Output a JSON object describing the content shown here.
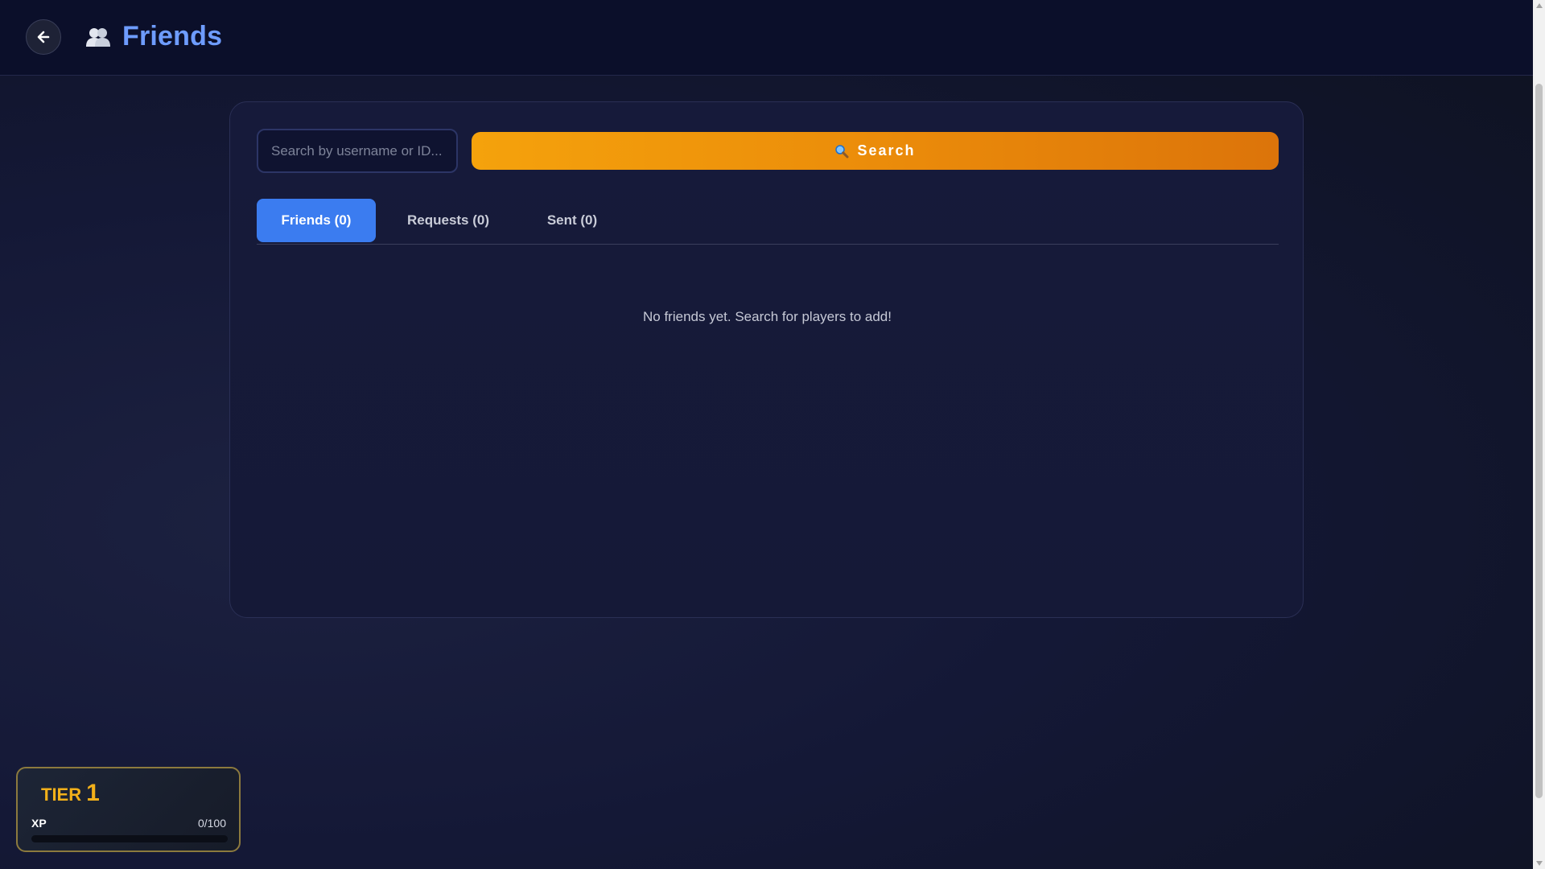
{
  "header": {
    "title": "Friends",
    "back_icon": "arrow-left-icon",
    "title_icon": "users-icon"
  },
  "search": {
    "placeholder": "Search by username or ID...",
    "value": "",
    "button_label": "Search",
    "button_icon": "magnifier-icon"
  },
  "tabs": [
    {
      "label": "Friends (0)",
      "active": true
    },
    {
      "label": "Requests (0)",
      "active": false
    },
    {
      "label": "Sent (0)",
      "active": false
    }
  ],
  "empty_state": "No friends yet. Search for players to add!",
  "tier_card": {
    "tier_label": "TIER",
    "tier_value": "1",
    "xp_label": "XP",
    "xp_value": "0/100",
    "xp_progress": 0
  },
  "colors": {
    "accent_blue": "#3b7cf0",
    "title_blue": "#6e9cff",
    "search_orange": "#f5a20c",
    "tier_gold": "#f2b01a"
  }
}
